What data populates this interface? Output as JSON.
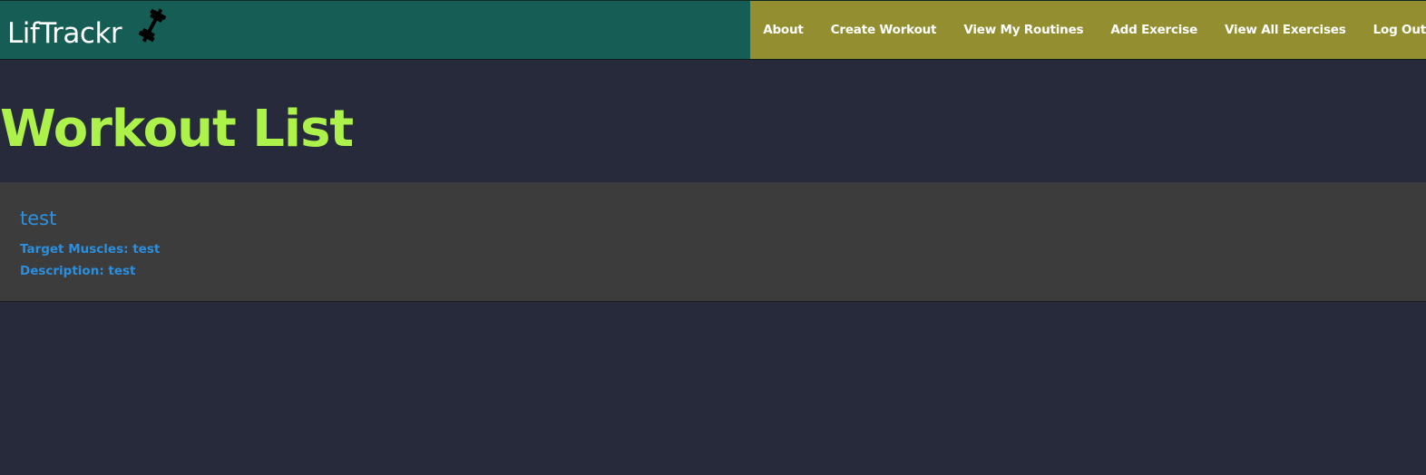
{
  "header": {
    "brand": "LifTrackr",
    "logo_icon": "dumbbell-icon",
    "colors": {
      "brand_bg": "#165e55",
      "nav_bg": "#938f31"
    },
    "nav": [
      {
        "label": "About"
      },
      {
        "label": "Create Workout"
      },
      {
        "label": "View My Routines"
      },
      {
        "label": "Add Exercise"
      },
      {
        "label": "View All Exercises"
      },
      {
        "label": "Log Out"
      }
    ]
  },
  "main": {
    "title": "Workout List",
    "title_color": "#adf24a",
    "workouts": [
      {
        "name": "test",
        "target_muscles": "Target Muscles: test",
        "description": "Description: test"
      }
    ]
  }
}
